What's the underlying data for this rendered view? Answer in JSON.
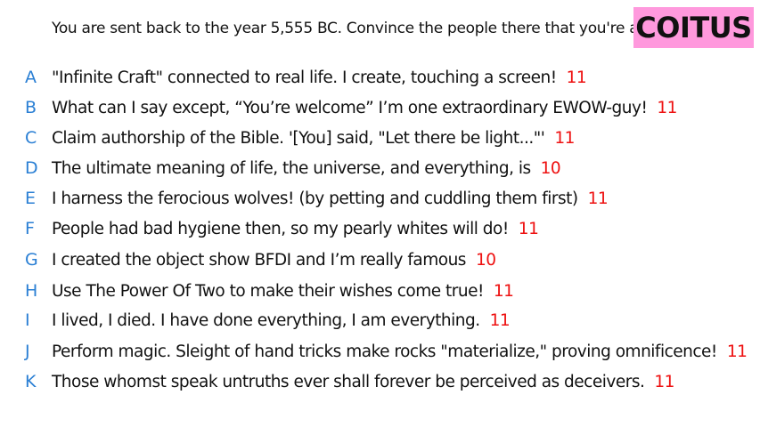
{
  "prompt": "You are sent back to the year 5,555 BC. Convince the people there that you're a god.",
  "title": "COITUS",
  "colors": {
    "badge_bg": "#ff99dd",
    "letter": "#2a7fd4",
    "score": "#ee1111",
    "text": "#111111"
  },
  "responses": [
    {
      "letter": "A",
      "text": "\"Infinite Craft\" connected to real life. I create, touching a screen!",
      "score": "11"
    },
    {
      "letter": "B",
      "text": "What can I say except, “You’re welcome” I’m one extraordinary EWOW-guy!",
      "score": "11"
    },
    {
      "letter": "C",
      "text": "Claim authorship of the Bible. '[You] said, \"Let there be light...\"'",
      "score": "11"
    },
    {
      "letter": "D",
      "text": "The ultimate meaning of life, the universe, and everything, is",
      "score": "10"
    },
    {
      "letter": "E",
      "text": "I harness the ferocious wolves! (by petting and cuddling them first)",
      "score": "11"
    },
    {
      "letter": "F",
      "text": "People had bad hygiene then, so my pearly whites will do!",
      "score": "11"
    },
    {
      "letter": "G",
      "text": "I created the object show BFDI and I’m really famous",
      "score": "10"
    },
    {
      "letter": "H",
      "text": "Use The Power Of Two to make their wishes come true!",
      "score": "11"
    },
    {
      "letter": "I",
      "text": "I lived, I died. I have done everything, I am everything.",
      "score": "11"
    },
    {
      "letter": "J",
      "text": "Perform magic. Sleight of hand tricks make rocks \"materialize,\" proving omnificence!",
      "score": "11"
    },
    {
      "letter": "K",
      "text": "Those whomst speak untruths ever shall forever be perceived as deceivers.",
      "score": "11"
    }
  ]
}
